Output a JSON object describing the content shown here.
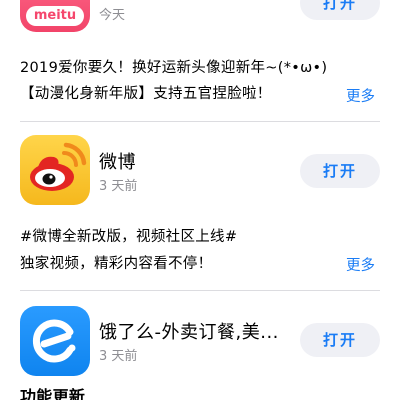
{
  "apps": [
    {
      "icon": "meitu-icon",
      "icon_text": "meitu",
      "date": "今天",
      "open_label": "打开",
      "desc_line1": "2019爱你要久！换好运新头像迎新年~(*•ω•)",
      "desc_line2": "【动漫化身新年版】支持五官捏脸啦！",
      "more_label": "更多"
    },
    {
      "icon": "weibo-icon",
      "name": "微博",
      "date": "3 天前",
      "open_label": "打开",
      "desc_line1": "#微博全新改版，视频社区上线#",
      "desc_line2": "独家视频，精彩内容看不停！",
      "more_label": "更多"
    },
    {
      "icon": "eleme-icon",
      "name": "饿了么-外卖订餐,美...",
      "date": "3 天前",
      "open_label": "打开",
      "desc_partial": "功能更新"
    }
  ],
  "colors": {
    "accent": "#1a7cf5",
    "button_bg": "#eff0f5",
    "meitu": "#f5476d",
    "weibo": "#f7c42c",
    "eleme": "#1d8cf5"
  }
}
